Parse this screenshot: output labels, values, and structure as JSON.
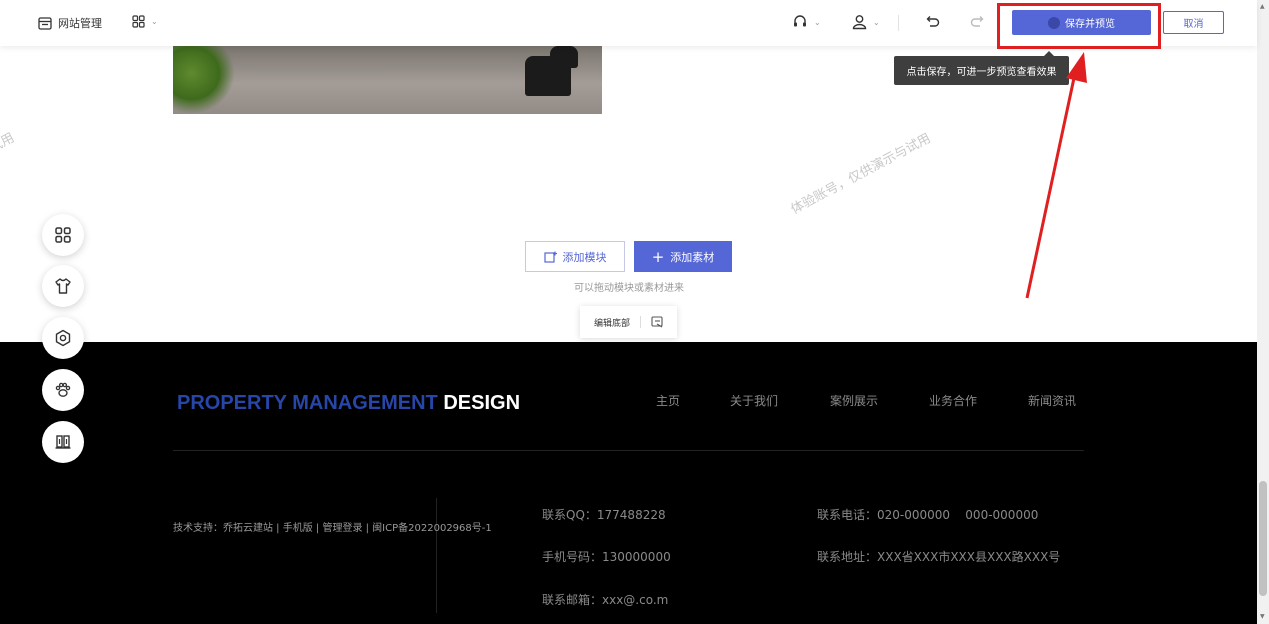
{
  "header": {
    "site_manage_label": "网站管理",
    "save_button_label": "保存并预览",
    "cancel_button_label": "取消",
    "tooltip_text": "点击保存，可进一步预览查看效果"
  },
  "canvas": {
    "watermark_text": "体验账号，仅供演示与试用",
    "watermark_partial": "试用",
    "add_module_label": "添加模块",
    "add_material_label": "添加素材",
    "drag_hint": "可以拖动模块或素材进来",
    "edit_footer_label": "编辑底部"
  },
  "footer": {
    "brand_part1": "PROPERTY MANAGEMENT",
    "brand_part2": "DESIGN",
    "nav": [
      "主页",
      "关于我们",
      "案例展示",
      "业务合作",
      "新闻资讯"
    ],
    "support": "技术支持：乔拓云建站 | 手机版 | 管理登录 | 闽ICP备2022002968号-1",
    "qq": "联系QQ：177488228",
    "mobile": "手机号码：130000000",
    "email": "联系邮箱：xxx@.co.m",
    "phone": "联系电话：020-000000    000-000000",
    "address": "联系地址：XXX省XXX市XXX县XXX路XXX号"
  },
  "colors": {
    "accent": "#5566d6",
    "annotation_red": "#e02020",
    "footer_bg": "#000000",
    "brand_blue": "#2746a8"
  },
  "floating_toolbar_icons": [
    "grid-icon",
    "shirt-icon",
    "settings-icon",
    "paw-icon",
    "building-icon"
  ]
}
